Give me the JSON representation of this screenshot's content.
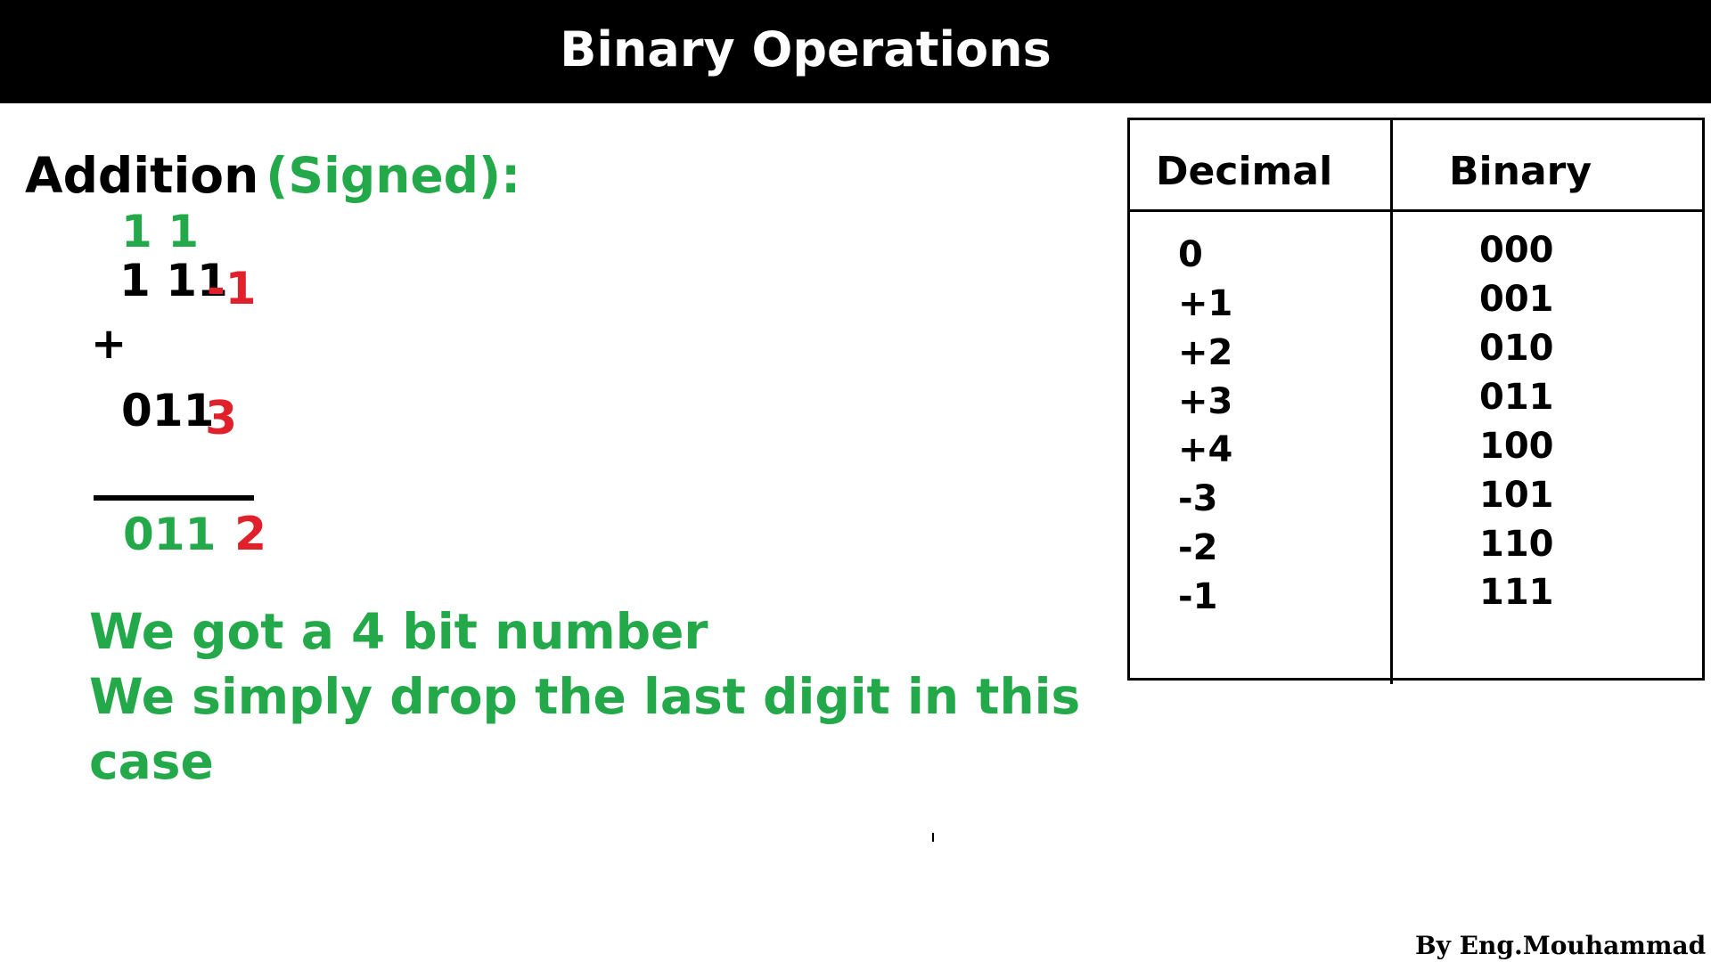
{
  "header": {
    "title": "Binary Operations"
  },
  "heading": {
    "main": "Addition",
    "sub": "(Signed):"
  },
  "calculation": {
    "carry": "1 1",
    "operand1": {
      "binary": "1 11",
      "decimal": "-1"
    },
    "operator": "+",
    "operand2": {
      "binary": "011",
      "decimal": "3"
    },
    "result": {
      "binary": "011",
      "decimal": "2"
    }
  },
  "notes": [
    "We got a 4 bit number",
    "We simply drop the last digit in this",
    "case"
  ],
  "table": {
    "headers": [
      "Decimal",
      "Binary"
    ],
    "rows": [
      {
        "decimal": "0",
        "binary": "000"
      },
      {
        "decimal": "+1",
        "binary": "001"
      },
      {
        "decimal": "+2",
        "binary": "010"
      },
      {
        "decimal": "+3",
        "binary": "011"
      },
      {
        "decimal": "+4",
        "binary": "100"
      },
      {
        "decimal": "-3",
        "binary": "101"
      },
      {
        "decimal": "-2",
        "binary": "110"
      },
      {
        "decimal": "-1",
        "binary": "111"
      }
    ]
  },
  "footer": {
    "credit": "By Eng.Mouhammad Hamsho"
  },
  "colors": {
    "header_bg": "#000000",
    "header_text": "#ffffff",
    "green": "#23a94a",
    "red": "#e0202a",
    "text": "#000000"
  }
}
